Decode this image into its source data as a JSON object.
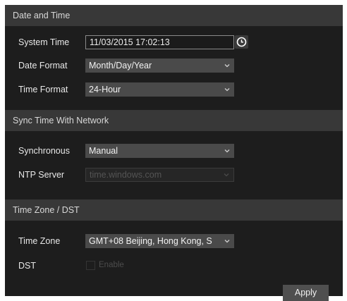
{
  "sections": {
    "date_time": "Date and Time",
    "sync": "Sync Time With Network",
    "timezone": "Time Zone / DST"
  },
  "fields": {
    "system_time": {
      "label": "System Time",
      "value": "11/03/2015 17:02:13"
    },
    "date_format": {
      "label": "Date Format",
      "value": "Month/Day/Year"
    },
    "time_format": {
      "label": "Time Format",
      "value": "24-Hour"
    },
    "synchronous": {
      "label": "Synchronous",
      "value": "Manual"
    },
    "ntp_server": {
      "label": "NTP Server",
      "value": "time.windows.com"
    },
    "time_zone": {
      "label": "Time Zone",
      "value": "GMT+08 Beijing, Hong Kong, S"
    },
    "dst": {
      "label": "DST",
      "checkbox_label": "Enable"
    }
  },
  "buttons": {
    "apply": "Apply"
  },
  "icons": {
    "clock": "clock-icon",
    "chevron": "chevron-down-icon"
  },
  "colors": {
    "panel_bg": "#1d1d1d",
    "header_bg": "#383838",
    "select_bg": "#4a4a4a"
  }
}
